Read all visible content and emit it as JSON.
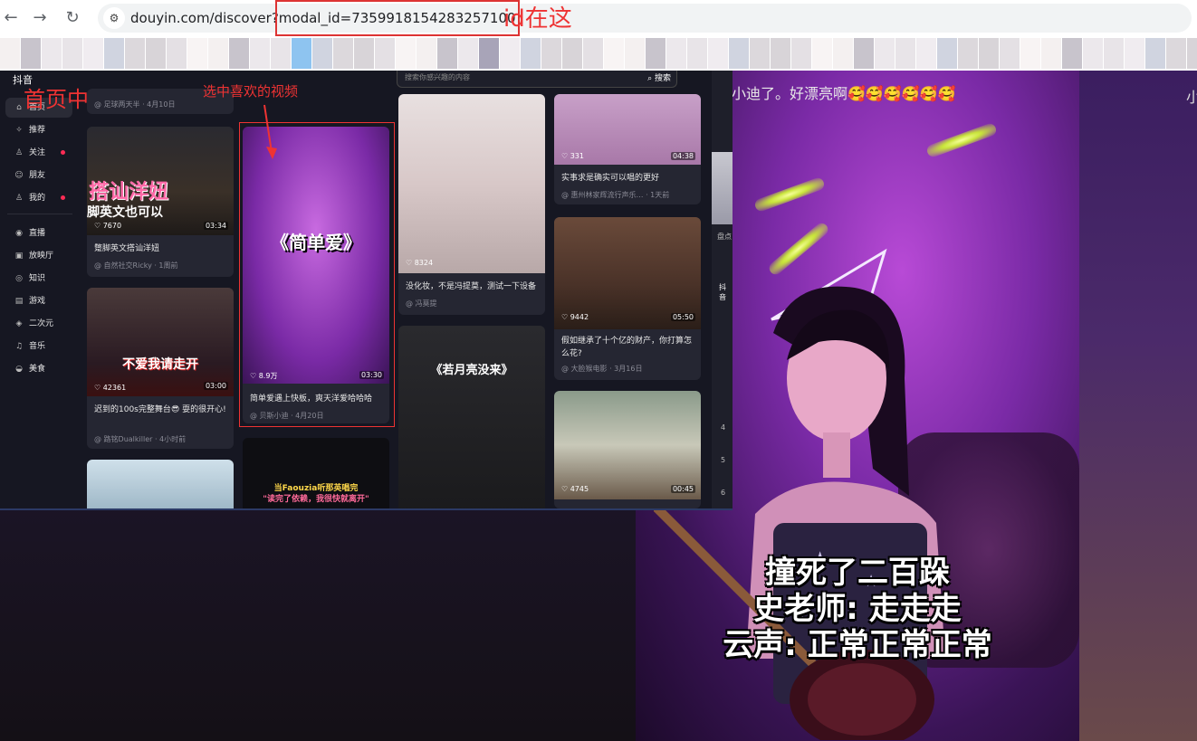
{
  "browser": {
    "back_icon": "back-arrow-icon",
    "forward_icon": "forward-arrow-icon",
    "reload_icon": "reload-icon",
    "url_prefix": "douyin.com/discover?",
    "url_param": "modal_id=7359918154283257100",
    "annotation_id": "id在这"
  },
  "inset": {
    "logo": "抖音",
    "annotation_home": "首页中",
    "annotation_pick": "选中喜欢的视频",
    "search_placeholder": "搜索你感兴趣的内容",
    "search_button": "搜索",
    "sidebar": [
      {
        "label": "首页",
        "icon": "home-icon"
      },
      {
        "label": "推荐",
        "icon": "sparkle-icon"
      },
      {
        "label": "关注",
        "icon": "follow-icon"
      },
      {
        "label": "朋友",
        "icon": "friends-icon"
      },
      {
        "label": "我的",
        "icon": "user-icon"
      },
      {
        "label": "直播",
        "icon": "live-icon"
      },
      {
        "label": "放映厅",
        "icon": "theater-icon"
      },
      {
        "label": "知识",
        "icon": "knowledge-icon"
      },
      {
        "label": "游戏",
        "icon": "game-icon"
      },
      {
        "label": "二次元",
        "icon": "anime-icon"
      },
      {
        "label": "音乐",
        "icon": "music-icon"
      },
      {
        "label": "美食",
        "icon": "food-icon"
      }
    ],
    "col1": [
      {
        "meta": "@ 足球两天半 · 4月10日"
      },
      {
        "overlay1": "搭讪洋妞",
        "overlay2": "脚英文也可以",
        "likes": "7670",
        "duration": "03:34",
        "title": "蹩脚英文搭讪洋妞",
        "meta": "@ 自然社交Ricky · 1周前"
      },
      {
        "overlay1": "不爱我请走开",
        "likes": "42361",
        "duration": "03:00",
        "title": "迟到的100s完整舞台😎 耍的很开心!",
        "meta": "@ 路铭Dualkiller · 4小时前"
      }
    ],
    "col2": [
      {
        "overlay1": "《简单爱》",
        "likes": "8.9万",
        "duration": "03:30",
        "title": "简单爱遇上快板，爽天洋爱哈哈哈",
        "meta": "@ 贝斯小迪 · 4月20日"
      },
      {
        "overlay1": "当Faouzia听那英唱完",
        "overlay2": "\"读完了依赖，我很快就离开\""
      }
    ],
    "col3": [
      {
        "likes": "8324",
        "title": "没化妆，不是冯提莫，测试一下设备",
        "meta": "@ 冯莫提"
      },
      {
        "overlay1": "《若月亮没来》"
      }
    ],
    "col4": [
      {
        "likes": "331",
        "duration": "04:38",
        "title": "实事求是确实可以唱的更好",
        "meta": "@ 惠州林家辉流行声乐… · 1天前"
      },
      {
        "likes": "9442",
        "duration": "05:50",
        "title": "假如继承了十个亿的财产，你打算怎么花?",
        "meta": "@ 大脸猴电影 · 3月16日"
      },
      {
        "likes": "4745",
        "duration": "00:45"
      }
    ],
    "rank": {
      "header": "抖音",
      "items": [
        "4",
        "5",
        "6"
      ],
      "peek": "盘点"
    }
  },
  "video": {
    "top_caption": "小迪了。好漂亮啊🥰🥰🥰🥰🥰🥰",
    "right_peek": "小",
    "subtitle_lines": [
      "撞死了二百跺",
      "史老师: 走走走",
      "云声: 正常正常正常"
    ]
  }
}
